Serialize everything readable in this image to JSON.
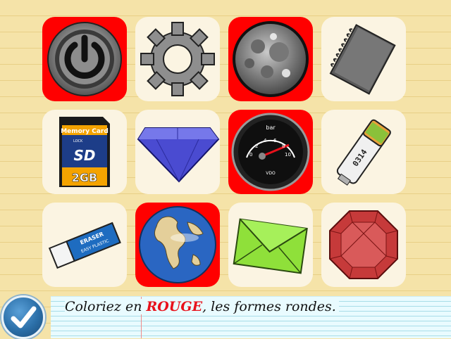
{
  "instruction": {
    "prefix": "Coloriez en ",
    "highlight": "ROUGE",
    "suffix": ", les formes rondes."
  },
  "tiles": [
    {
      "name": "power-button-icon",
      "selected": true
    },
    {
      "name": "gear-icon",
      "selected": false
    },
    {
      "name": "moon-icon",
      "selected": true
    },
    {
      "name": "spiral-notebook-icon",
      "selected": false
    },
    {
      "name": "sd-card-icon",
      "selected": false,
      "text": {
        "brand": "Memory Card",
        "sd": "SD",
        "lock": "LOCK",
        "capacity": "2GB"
      }
    },
    {
      "name": "blue-diamond-icon",
      "selected": false
    },
    {
      "name": "oil-gauge-icon",
      "selected": true,
      "text": {
        "unit": "bar",
        "brand": "VDO",
        "ticks": [
          "0",
          "2",
          "4",
          "6",
          "8",
          "10"
        ]
      }
    },
    {
      "name": "battery-icon",
      "selected": false,
      "text": {
        "code": "0314"
      }
    },
    {
      "name": "eraser-icon",
      "selected": false,
      "text": {
        "brand": "ERASER",
        "sub": "EASY PLASTIC"
      }
    },
    {
      "name": "earth-globe-icon",
      "selected": true
    },
    {
      "name": "envelope-icon",
      "selected": false
    },
    {
      "name": "red-gem-icon",
      "selected": false
    }
  ],
  "colors": {
    "selected": "#ff0000",
    "tile": "#fbf4e2",
    "highlight": "#e8111b"
  },
  "ok_button": {
    "icon": "checkmark-icon"
  }
}
